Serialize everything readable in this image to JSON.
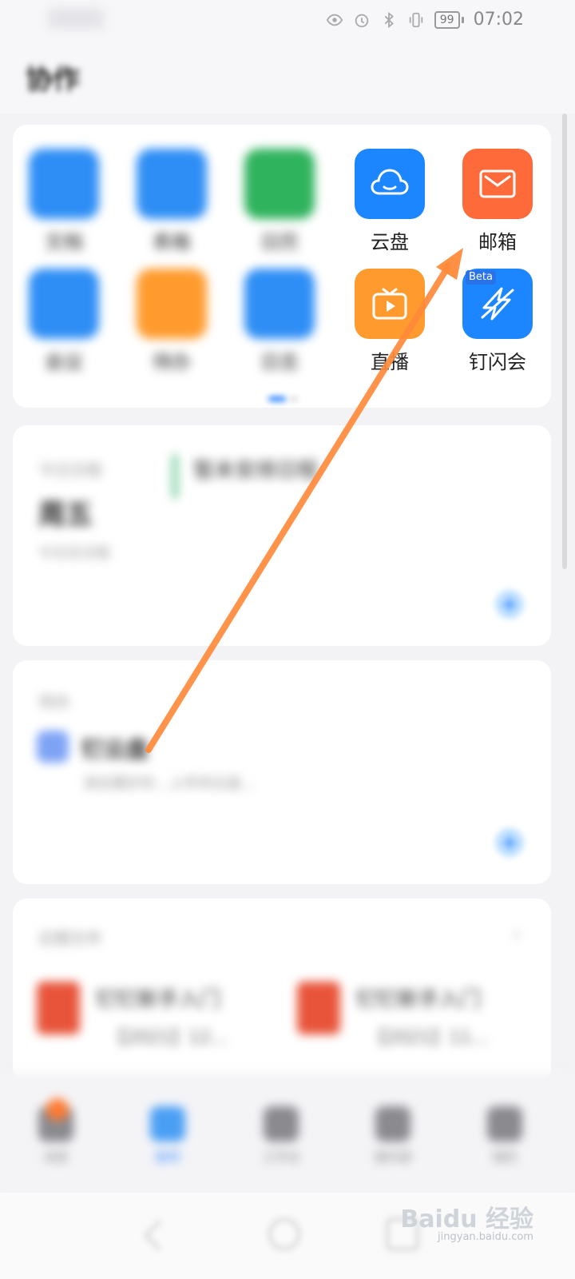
{
  "status_bar": {
    "battery": "99",
    "time": "07:02"
  },
  "header": {
    "title": "协作"
  },
  "apps": [
    {
      "label": "文档",
      "color": "#2e8ef5",
      "icon": "doc-icon",
      "blurred": true
    },
    {
      "label": "表格",
      "color": "#2e8ef5",
      "icon": "sheet-icon",
      "blurred": true
    },
    {
      "label": "日历",
      "color": "#2fb35d",
      "icon": "calendar-icon",
      "blurred": true
    },
    {
      "label": "云盘",
      "color": "#1b86ff",
      "icon": "cloud-icon",
      "blurred": false
    },
    {
      "label": "邮箱",
      "color": "#ff6a3a",
      "icon": "mail-icon",
      "blurred": false
    },
    {
      "label": "会议",
      "color": "#2e8ef5",
      "icon": "video-icon",
      "blurred": true
    },
    {
      "label": "待办",
      "color": "#ff9b2e",
      "icon": "todo-icon",
      "blurred": true
    },
    {
      "label": "日志",
      "color": "#2e8ef5",
      "icon": "log-icon",
      "blurred": true
    },
    {
      "label": "直播",
      "color": "#ff9b2e",
      "icon": "tv-icon",
      "blurred": false
    },
    {
      "label": "钉闪会",
      "color": "#1b86ff",
      "icon": "flash-icon",
      "blurred": false,
      "badge": "Beta"
    }
  ],
  "schedule": {
    "caption": "今日日程",
    "day": "周五",
    "sub": "今日无日程",
    "event": "暂未安排日程"
  },
  "todo": {
    "caption": "待办",
    "name": "钉云盘",
    "desc": "请设置好你…上传到云盘…"
  },
  "recent_files": {
    "caption": "近期文件",
    "files": [
      {
        "name": "钉钉新手入门",
        "sub": "【2021】12..."
      },
      {
        "name": "钉钉新手入门",
        "sub": "【2021】11..."
      }
    ]
  },
  "bottom_nav": [
    "消息",
    "协作",
    "工作台",
    "通讯录",
    "我的"
  ],
  "watermark": {
    "brand": "Baidu 经验",
    "url": "jingyan.baidu.com"
  }
}
